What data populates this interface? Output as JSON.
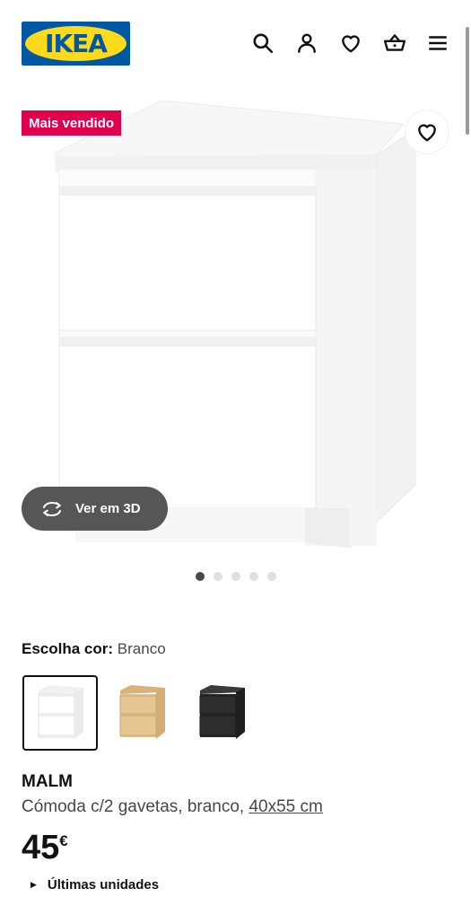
{
  "header": {
    "logo_text": "IKEA",
    "icons": [
      "search-icon",
      "user-icon",
      "heart-icon",
      "basket-icon",
      "menu-icon"
    ]
  },
  "hero": {
    "badge": "Mais vendido",
    "view_3d_label": "Ver em 3D",
    "carousel": {
      "total": 5,
      "active": 1
    }
  },
  "color": {
    "label": "Escolha cor:",
    "value": "Branco",
    "options": [
      {
        "name": "white",
        "color": "#f4f4f4",
        "selected": true
      },
      {
        "name": "oak",
        "color": "#e2c290",
        "selected": false
      },
      {
        "name": "black",
        "color": "#2b2b2b",
        "selected": false
      }
    ]
  },
  "product": {
    "name": "MALM",
    "description": "Cómoda c/2 gavetas, branco,",
    "dimensions": "40x55 cm",
    "price": "45",
    "currency": "€",
    "stock": "Últimas unidades"
  },
  "colors": {
    "badge_bg": "#e0004d",
    "logo_blue": "#0058a3",
    "logo_yellow": "#ffda1a"
  }
}
